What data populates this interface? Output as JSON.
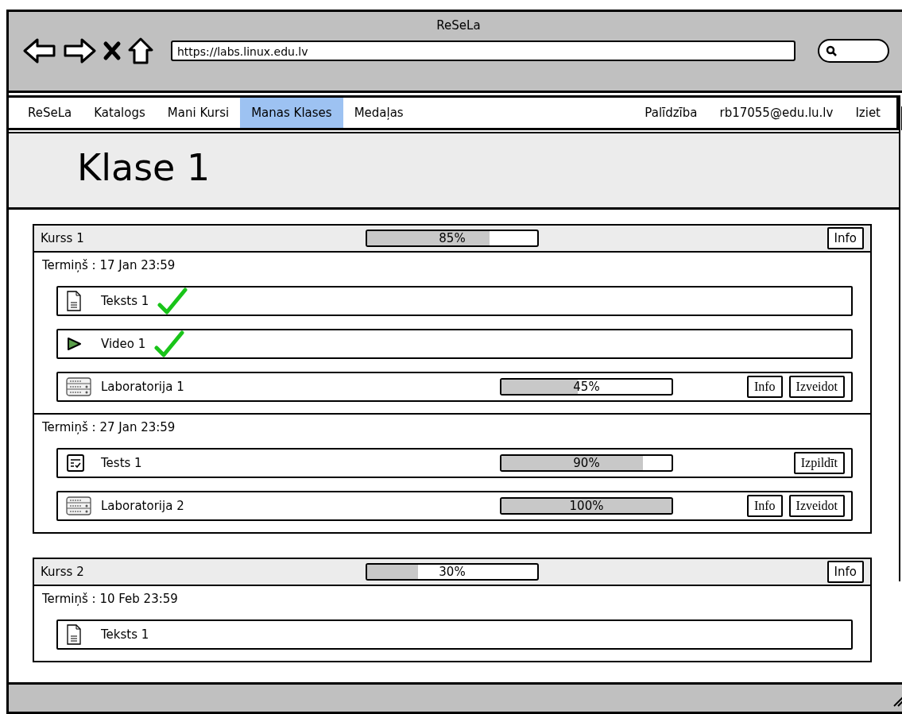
{
  "window": {
    "title": "ReSeLa",
    "url": "https://labs.linux.edu.lv"
  },
  "nav": {
    "left": [
      {
        "label": "ReSeLa",
        "selected": false
      },
      {
        "label": "Katalogs",
        "selected": false
      },
      {
        "label": "Mani Kursi",
        "selected": false
      },
      {
        "label": "Manas Klases",
        "selected": true
      },
      {
        "label": "Medaļas",
        "selected": false
      }
    ],
    "right": [
      "Palīdzība",
      "rb17055@edu.lu.lv",
      "Iziet"
    ]
  },
  "page_title": "Klase 1",
  "courses": [
    {
      "name": "Kurss 1",
      "level": 0.72,
      "reading": "85%",
      "button": "Info",
      "sections": [
        {
          "deadline": "Termiņš : 17 Jan 23:59",
          "items": [
            {
              "kind": "text",
              "label": "Teksts 1",
              "done": true
            },
            {
              "kind": "video",
              "label": "Video 1",
              "done": true
            },
            {
              "kind": "lab",
              "label": "Laboratorija 1",
              "done": false,
              "level": 0.45,
              "reading": "45%",
              "buttons": [
                "Info",
                "Izveidot"
              ]
            }
          ]
        },
        {
          "deadline": "Termiņš : 27 Jan 23:59",
          "items": [
            {
              "kind": "test",
              "label": "Tests 1",
              "done": false,
              "level": 0.83,
              "reading": "90%",
              "buttons": [
                "Izpildīt"
              ]
            },
            {
              "kind": "lab",
              "label": "Laboratorija 2",
              "done": false,
              "level": 1,
              "reading": "100%",
              "buttons": [
                "Info",
                "Izveidot"
              ]
            }
          ]
        }
      ]
    },
    {
      "name": "Kurss 2",
      "level": 0.3,
      "reading": "30%",
      "button": "Info",
      "sections": [
        {
          "deadline": "Termiņš : 10 Feb 23:59",
          "items": [
            {
              "kind": "text",
              "label": "Teksts 1",
              "done": false
            }
          ]
        }
      ]
    }
  ]
}
